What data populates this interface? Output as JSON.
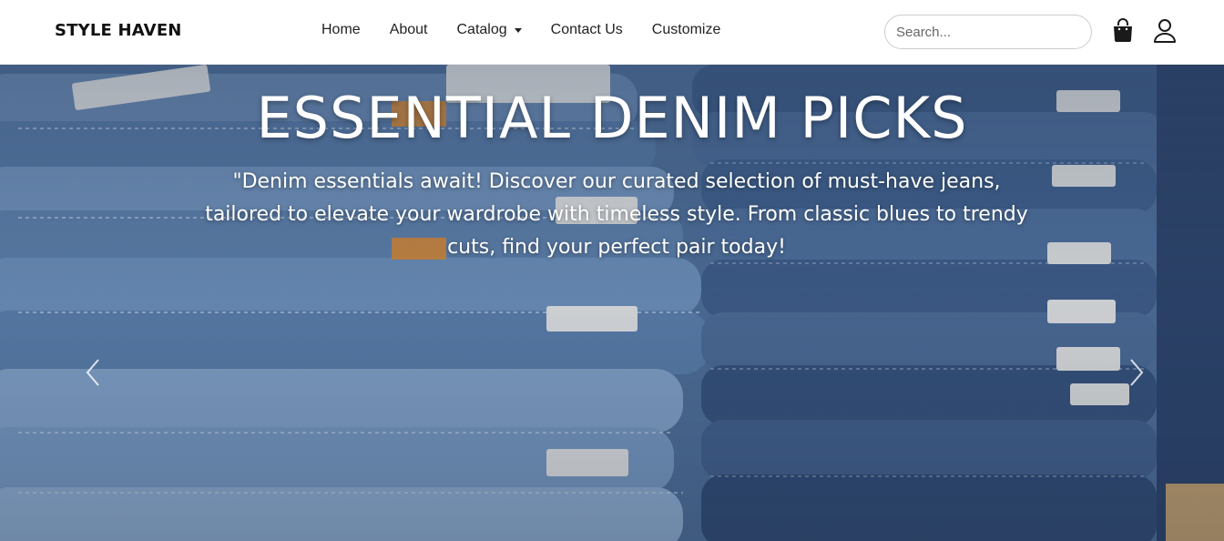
{
  "brand": {
    "name": "STYLE HAVEN"
  },
  "nav": {
    "items": [
      {
        "label": "Home"
      },
      {
        "label": "About"
      },
      {
        "label": "Catalog"
      },
      {
        "label": "Contact Us"
      },
      {
        "label": "Customize"
      }
    ]
  },
  "search": {
    "placeholder": "Search..."
  },
  "icons": {
    "cart": "shopping-bag-icon",
    "account": "user-icon",
    "prev": "chevron-left-icon",
    "next": "chevron-right-icon"
  },
  "hero": {
    "headline": "ESSENTIAL DENIM PICKS",
    "subtext": "\"Denim essentials await! Discover our curated selection of must-have jeans, tailored to elevate your wardrobe with timeless style. From classic blues to trendy cuts, find your perfect pair today!"
  },
  "colors": {
    "navbar_bg": "#ffffff",
    "text": "#212529",
    "hero_text": "#ffffff"
  }
}
